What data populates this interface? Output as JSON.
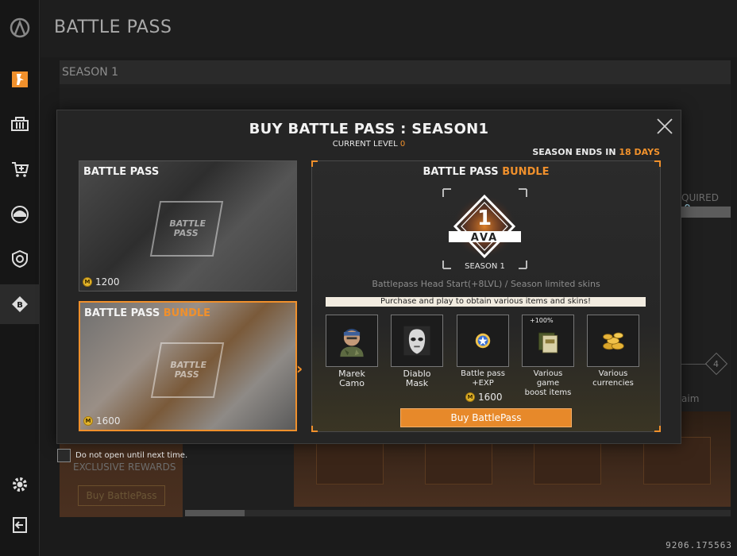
{
  "header": {
    "title": "BATTLE PASS",
    "season_tab": "SEASON 1"
  },
  "sidebar": {
    "items": [
      {
        "name": "logo"
      },
      {
        "name": "play"
      },
      {
        "name": "inventory"
      },
      {
        "name": "shop"
      },
      {
        "name": "clan"
      },
      {
        "name": "rank"
      },
      {
        "name": "battle-pass",
        "active": true
      },
      {
        "name": "settings"
      },
      {
        "name": "exit"
      }
    ]
  },
  "background": {
    "required_label": "QUIRED",
    "step_number": "4",
    "claim_label": "aim",
    "exclusive_rewards": "EXCLUSIVE REWARDS",
    "buy_label": "Buy BattlePass"
  },
  "modal": {
    "title": "BUY BATTLE PASS : SEASON1",
    "current_level_label": "CURRENT LEVEL",
    "current_level_value": "0",
    "season_ends_label": "SEASON ENDS IN",
    "season_ends_value": "18 DAYS",
    "options": [
      {
        "label": "BATTLE PASS",
        "label_accent": "",
        "price": "1200",
        "emblem_text": "BATTLE PASS"
      },
      {
        "label": "BATTLE PASS",
        "label_accent": "BUNDLE",
        "price": "1600",
        "emblem_text": "BATTLE PASS",
        "selected": true
      }
    ],
    "detail": {
      "title": "BATTLE PASS",
      "title_accent": "BUNDLE",
      "emblem_number": "1",
      "emblem_brand": "AVA",
      "emblem_season": "SEASON 1",
      "description": "Battlepass Head Start(+8LVL) / Season limited skins",
      "banner": "Purchase and play to obtain various items and skins!",
      "items": [
        {
          "name": "Marek Camo"
        },
        {
          "name": "Diablo Mask"
        },
        {
          "name_line1": "Battle pass",
          "name_line2": "+EXP"
        },
        {
          "name_line1": "Various game",
          "name_line2": "boost items",
          "badge": "+100%"
        },
        {
          "name_line1": "Various",
          "name_line2": "currencies"
        }
      ],
      "price": "1600",
      "buy_button": "Buy BattlePass"
    },
    "do_not_open_label": "Do not open until next time."
  },
  "version": "9206.175563",
  "colors": {
    "accent": "#f0902c",
    "coin": "#e3b42a"
  }
}
